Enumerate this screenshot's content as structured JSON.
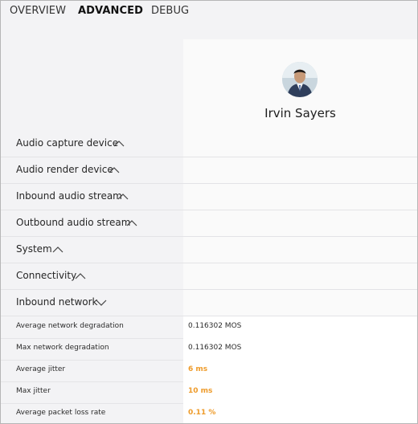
{
  "tabs": [
    {
      "label": "OVERVIEW"
    },
    {
      "label": "ADVANCED"
    },
    {
      "label": "DEBUG"
    }
  ],
  "participant": {
    "name": "Irvin Sayers"
  },
  "sections": [
    {
      "label": "Audio capture device",
      "state": "collapsed",
      "icon": "chevron-up-icon"
    },
    {
      "label": "Audio render device",
      "state": "collapsed",
      "icon": "chevron-up-icon"
    },
    {
      "label": "Inbound audio stream",
      "state": "collapsed",
      "icon": "chevron-up-icon"
    },
    {
      "label": "Outbound audio stream",
      "state": "collapsed",
      "icon": "chevron-up-icon"
    },
    {
      "label": "System",
      "state": "collapsed",
      "icon": "chevron-up-icon"
    },
    {
      "label": "Connectivity",
      "state": "collapsed",
      "icon": "chevron-up-icon"
    },
    {
      "label": "Inbound network",
      "state": "expanded",
      "icon": "chevron-down-icon"
    }
  ],
  "metrics": [
    {
      "label": "Average network degradation",
      "value": "0.116302 MOS",
      "status": "normal"
    },
    {
      "label": "Max network degradation",
      "value": "0.116302 MOS",
      "status": "normal"
    },
    {
      "label": "Average jitter",
      "value": "6 ms",
      "status": "warning"
    },
    {
      "label": "Max jitter",
      "value": "10 ms",
      "status": "warning"
    },
    {
      "label": "Average packet loss rate",
      "value": "0.11 %",
      "status": "warning"
    }
  ],
  "colors": {
    "warning": "#ee9b2a",
    "background": "#f3f3f5",
    "value_background": "#ffffff"
  }
}
